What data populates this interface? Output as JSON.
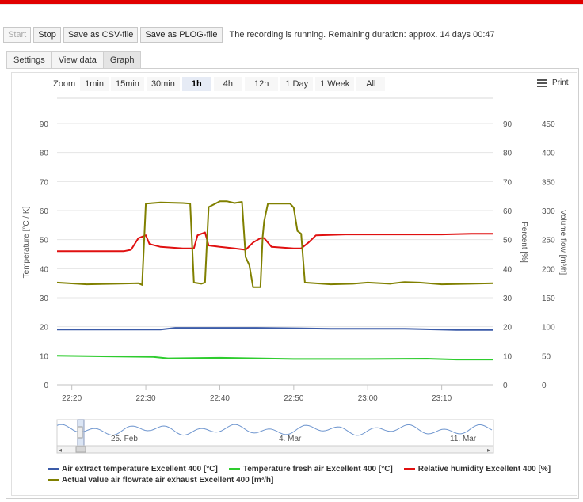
{
  "toolbar": {
    "start_label": "Start",
    "stop_label": "Stop",
    "csv_label": "Save as CSV-file",
    "plog_label": "Save as PLOG-file",
    "status": "The recording is running.  Remaining duration: approx. 14 days 00:47"
  },
  "tabs": [
    {
      "label": "Settings",
      "active": false
    },
    {
      "label": "View data",
      "active": false
    },
    {
      "label": "Graph",
      "active": true
    }
  ],
  "zoom": {
    "label": "Zoom",
    "options": [
      "1min",
      "15min",
      "30min",
      "1h",
      "4h",
      "12h",
      "1 Day",
      "1 Week",
      "All"
    ],
    "selected": "1h"
  },
  "print_label": "Print",
  "chart_data": {
    "type": "line",
    "x_ticks": [
      "22:20",
      "22:30",
      "22:40",
      "22:50",
      "23:00",
      "23:10"
    ],
    "y_left": {
      "label": "Temperature [°C / K]",
      "ticks": [
        0,
        10,
        20,
        30,
        40,
        50,
        60,
        70,
        80,
        90
      ],
      "range": [
        0,
        90
      ]
    },
    "y_mid": {
      "label": "Percent [%]",
      "ticks": [
        0,
        10,
        20,
        30,
        40,
        50,
        60,
        70,
        80,
        90
      ],
      "range": [
        0,
        90
      ]
    },
    "y_right": {
      "label": "Volume flow [m³/h]",
      "ticks": [
        0,
        50,
        100,
        150,
        200,
        250,
        300,
        350,
        400,
        450
      ],
      "range": [
        0,
        450
      ]
    },
    "grid": true,
    "series": [
      {
        "name": "Air extract temperature Excellent 400 [°C]",
        "color": "#3b5ba8",
        "axis": "left",
        "points": [
          [
            "22:18",
            19
          ],
          [
            "22:32",
            19
          ],
          [
            "22:34",
            19.6
          ],
          [
            "22:45",
            19.6
          ],
          [
            "22:55",
            19.3
          ],
          [
            "23:05",
            19.3
          ],
          [
            "23:12",
            18.9
          ],
          [
            "23:17",
            18.9
          ]
        ]
      },
      {
        "name": "Temperature fresh air Excellent 400 [°C]",
        "color": "#2ecc2e",
        "axis": "left",
        "points": [
          [
            "22:18",
            10
          ],
          [
            "22:25",
            9.8
          ],
          [
            "22:31",
            9.6
          ],
          [
            "22:33",
            9.1
          ],
          [
            "22:40",
            9.3
          ],
          [
            "22:50",
            8.9
          ],
          [
            "23:00",
            8.9
          ],
          [
            "23:08",
            9
          ],
          [
            "23:12",
            8.7
          ],
          [
            "23:17",
            8.7
          ]
        ]
      },
      {
        "name": "Relative humidity Excellent 400 [%]",
        "color": "#e01010",
        "axis": "mid",
        "points": [
          [
            "22:18",
            46
          ],
          [
            "22:27",
            46
          ],
          [
            "22:28",
            46.5
          ],
          [
            "22:29",
            50.5
          ],
          [
            "22:30",
            51.5
          ],
          [
            "22:30.5",
            48.5
          ],
          [
            "22:32",
            47.5
          ],
          [
            "22:35",
            47
          ],
          [
            "22:36.5",
            47
          ],
          [
            "22:37",
            51.5
          ],
          [
            "22:38",
            52.5
          ],
          [
            "22:38.5",
            48
          ],
          [
            "22:40",
            47.5
          ],
          [
            "22:42",
            47
          ],
          [
            "22:43.5",
            46.5
          ],
          [
            "22:44.5",
            49
          ],
          [
            "22:45.5",
            50.5
          ],
          [
            "22:46",
            50.5
          ],
          [
            "22:47",
            47.5
          ],
          [
            "22:50",
            47
          ],
          [
            "22:51",
            47
          ],
          [
            "22:52",
            49
          ],
          [
            "22:53",
            51.5
          ],
          [
            "22:57",
            51.8
          ],
          [
            "23:10",
            51.8
          ],
          [
            "23:14",
            52
          ],
          [
            "23:17",
            52
          ]
        ]
      },
      {
        "name": "Actual value air flowrate air exhaust Excellent 400 [m³/h]",
        "color": "#808000",
        "axis": "right",
        "points": [
          [
            "22:18",
            176
          ],
          [
            "22:22",
            173
          ],
          [
            "22:26",
            174
          ],
          [
            "22:29",
            175
          ],
          [
            "22:29.5",
            172
          ],
          [
            "22:30",
            312
          ],
          [
            "22:32",
            314
          ],
          [
            "22:35",
            313
          ],
          [
            "22:36",
            312
          ],
          [
            "22:36.5",
            176
          ],
          [
            "22:37.5",
            174
          ],
          [
            "22:38",
            176
          ],
          [
            "22:38.5",
            306
          ],
          [
            "22:40",
            316
          ],
          [
            "22:41",
            316
          ],
          [
            "22:42",
            313
          ],
          [
            "22:43",
            315
          ],
          [
            "22:43.5",
            220
          ],
          [
            "22:44",
            206
          ],
          [
            "22:44.5",
            168
          ],
          [
            "22:45.5",
            168
          ],
          [
            "22:45.8",
            255
          ],
          [
            "22:46",
            282
          ],
          [
            "22:46.5",
            312
          ],
          [
            "22:49.5",
            312
          ],
          [
            "22:50",
            305
          ],
          [
            "22:50.5",
            265
          ],
          [
            "22:51",
            260
          ],
          [
            "22:51.5",
            176
          ],
          [
            "22:55",
            173
          ],
          [
            "22:58",
            174
          ],
          [
            "23:00",
            176
          ],
          [
            "23:03",
            174
          ],
          [
            "23:05",
            177
          ],
          [
            "23:07",
            176
          ],
          [
            "23:10",
            173
          ],
          [
            "23:14",
            174
          ],
          [
            "23:17",
            175
          ]
        ]
      }
    ]
  },
  "navigator": {
    "labels": [
      "25. Feb",
      "4. Mar",
      "11. Mar"
    ]
  },
  "legend": [
    {
      "label": "Air extract temperature Excellent 400 [°C]",
      "color": "#3b5ba8"
    },
    {
      "label": "Temperature fresh air Excellent 400 [°C]",
      "color": "#2ecc2e"
    },
    {
      "label": "Relative humidity Excellent 400 [%]",
      "color": "#e01010"
    },
    {
      "label": "Actual value air flowrate air exhaust Excellent 400 [m³/h]",
      "color": "#808000"
    }
  ]
}
